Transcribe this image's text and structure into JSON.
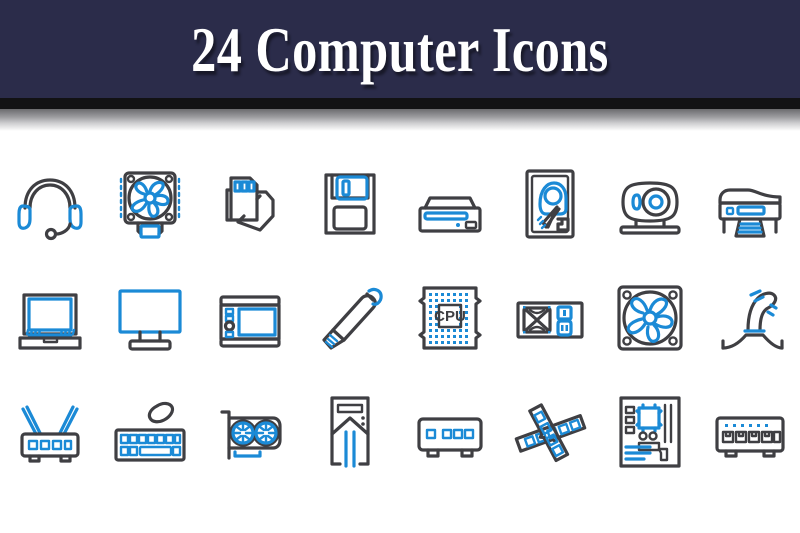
{
  "header": {
    "title": "24 Computer Icons",
    "background_color": "#2b2c4a",
    "rule_color": "#121214",
    "title_color": "#ffffff"
  },
  "palette": {
    "accent_blue": "#1b8ad6",
    "outline_dark": "#3f3f43",
    "page_background": "#ffffff"
  },
  "icon_set": {
    "count": 24,
    "columns": 8,
    "rows": 3,
    "style": "line-art duotone",
    "labels": {
      "cpu_chip_text": "CPU"
    },
    "icons": [
      {
        "index": 1,
        "name": "headset-icon",
        "row": 1,
        "column": 1
      },
      {
        "index": 2,
        "name": "cpu-cooler-fan-icon",
        "row": 1,
        "column": 2
      },
      {
        "index": 3,
        "name": "memory-card-icon",
        "row": 1,
        "column": 3
      },
      {
        "index": 4,
        "name": "floppy-disk-icon",
        "row": 1,
        "column": 4
      },
      {
        "index": 5,
        "name": "optical-drive-icon",
        "row": 1,
        "column": 5
      },
      {
        "index": 6,
        "name": "hard-disk-drive-icon",
        "row": 1,
        "column": 6
      },
      {
        "index": 7,
        "name": "projector-icon",
        "row": 1,
        "column": 7
      },
      {
        "index": 8,
        "name": "printer-scanner-icon",
        "row": 1,
        "column": 8
      },
      {
        "index": 9,
        "name": "laptop-icon",
        "row": 2,
        "column": 1
      },
      {
        "index": 10,
        "name": "monitor-icon",
        "row": 2,
        "column": 2
      },
      {
        "index": 11,
        "name": "graphics-tablet-icon",
        "row": 2,
        "column": 3
      },
      {
        "index": 12,
        "name": "usb-flash-drive-icon",
        "row": 2,
        "column": 4
      },
      {
        "index": 13,
        "name": "cpu-chip-icon",
        "row": 2,
        "column": 5
      },
      {
        "index": 14,
        "name": "power-supply-icon",
        "row": 2,
        "column": 6
      },
      {
        "index": 15,
        "name": "case-fan-icon",
        "row": 2,
        "column": 7
      },
      {
        "index": 16,
        "name": "joystick-icon",
        "row": 2,
        "column": 8
      },
      {
        "index": 17,
        "name": "wifi-router-icon",
        "row": 3,
        "column": 1
      },
      {
        "index": 18,
        "name": "keyboard-mouse-icon",
        "row": 3,
        "column": 2
      },
      {
        "index": 19,
        "name": "graphics-card-icon",
        "row": 3,
        "column": 3
      },
      {
        "index": 20,
        "name": "computer-tower-icon",
        "row": 3,
        "column": 4
      },
      {
        "index": 21,
        "name": "modem-icon",
        "row": 3,
        "column": 5
      },
      {
        "index": 22,
        "name": "ram-memory-icon",
        "row": 3,
        "column": 6
      },
      {
        "index": 23,
        "name": "motherboard-icon",
        "row": 3,
        "column": 7
      },
      {
        "index": 24,
        "name": "network-switch-icon",
        "row": 3,
        "column": 8
      }
    ]
  }
}
